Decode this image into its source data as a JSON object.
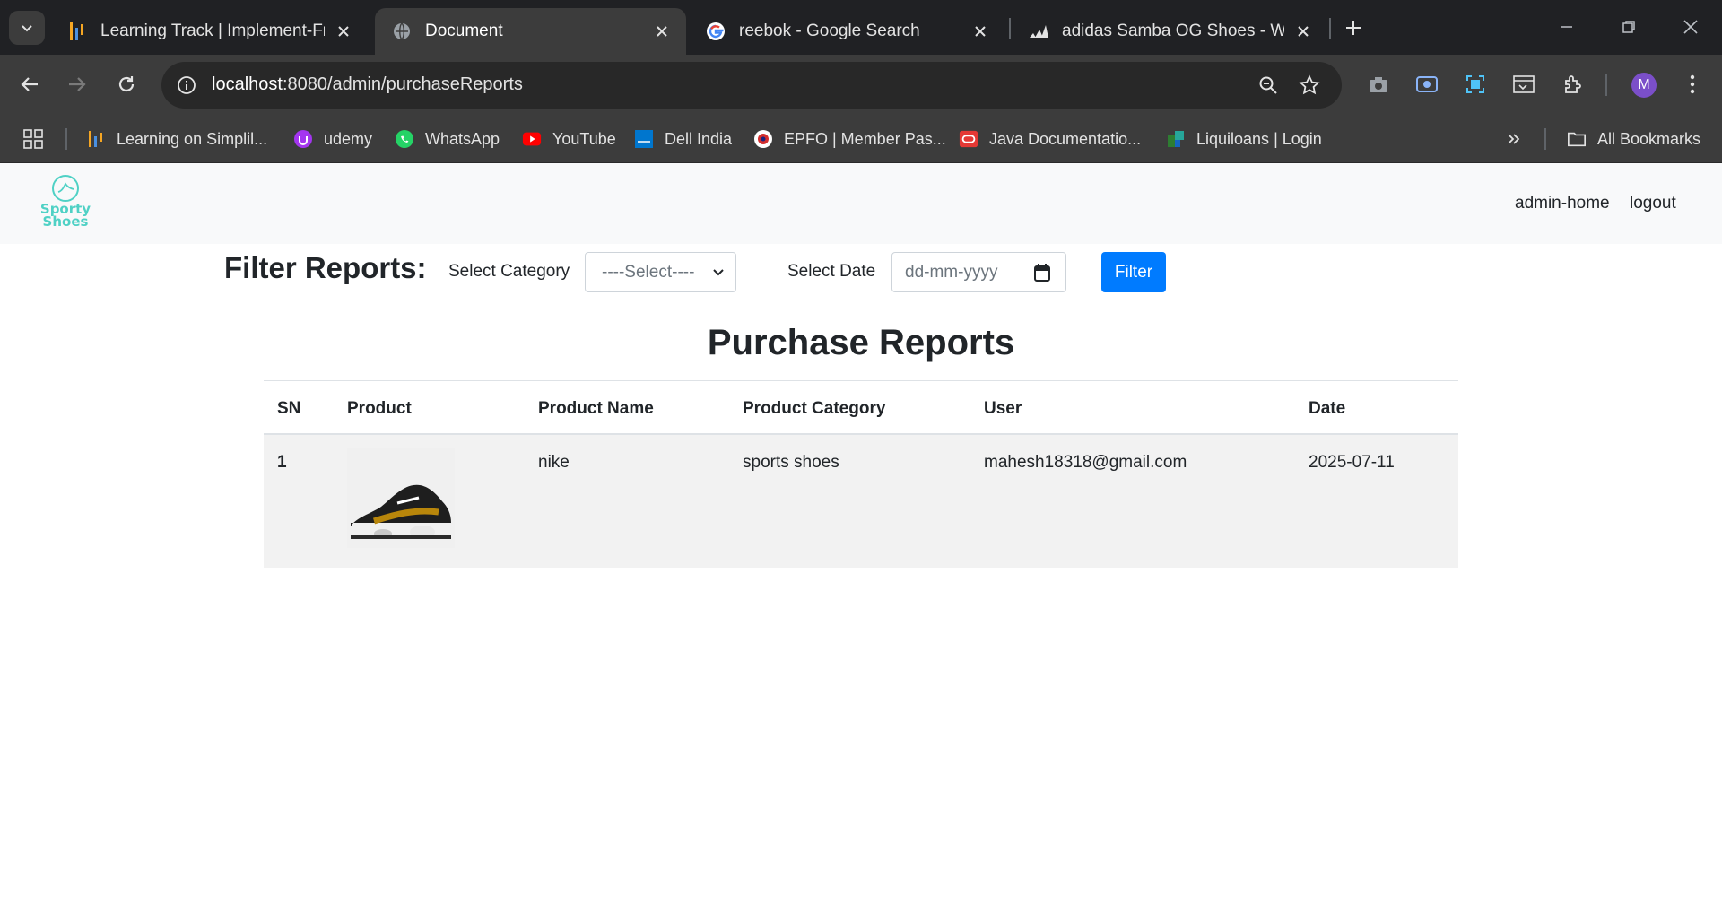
{
  "browser": {
    "tabs": [
      {
        "title": "Learning Track | Implement-Fra",
        "icon": "simplilearn-icon"
      },
      {
        "title": "Document",
        "icon": "globe-icon",
        "active": true
      },
      {
        "title": "reebok - Google Search",
        "icon": "google-icon"
      },
      {
        "title": "adidas Samba OG Shoes - Whit",
        "icon": "adidas-icon"
      }
    ],
    "url_host": "localhost",
    "url_rest": ":8080/admin/purchaseReports",
    "avatar_letter": "M",
    "bookmarks": [
      {
        "label": "Learning on Simplil...",
        "icon": "simplilearn-icon"
      },
      {
        "label": "udemy",
        "icon": "udemy-icon"
      },
      {
        "label": "WhatsApp",
        "icon": "whatsapp-icon"
      },
      {
        "label": "YouTube",
        "icon": "youtube-icon"
      },
      {
        "label": "Dell India",
        "icon": "dell-icon"
      },
      {
        "label": "EPFO | Member Pas...",
        "icon": "epfo-icon"
      },
      {
        "label": "Java Documentatio...",
        "icon": "oracle-icon"
      },
      {
        "label": "Liquiloans | Login",
        "icon": "liquiloans-icon"
      }
    ],
    "all_bookmarks": "All Bookmarks"
  },
  "navbar": {
    "logo_line1": "Sporty",
    "logo_line2": "Shoes",
    "links": [
      "admin-home",
      "logout"
    ]
  },
  "filter": {
    "title": "Filter Reports:",
    "category_label": "Select Category",
    "category_value": "----Select----",
    "date_label": "Select Date",
    "date_placeholder": "dd-mm-yyyy",
    "button": "Filter"
  },
  "report": {
    "title": "Purchase Reports",
    "columns": [
      "SN",
      "Product",
      "Product Name",
      "Product Category",
      "User",
      "Date"
    ],
    "rows": [
      {
        "sn": "1",
        "product_name": "nike",
        "category": "sports shoes",
        "user": "mahesh18318@gmail.com",
        "date": "2025-07-11"
      }
    ]
  },
  "colors": {
    "accent": "#007bff",
    "chrome_dark": "#202124",
    "chrome_mid": "#3c3c3c",
    "logo": "#4fd1c5"
  }
}
